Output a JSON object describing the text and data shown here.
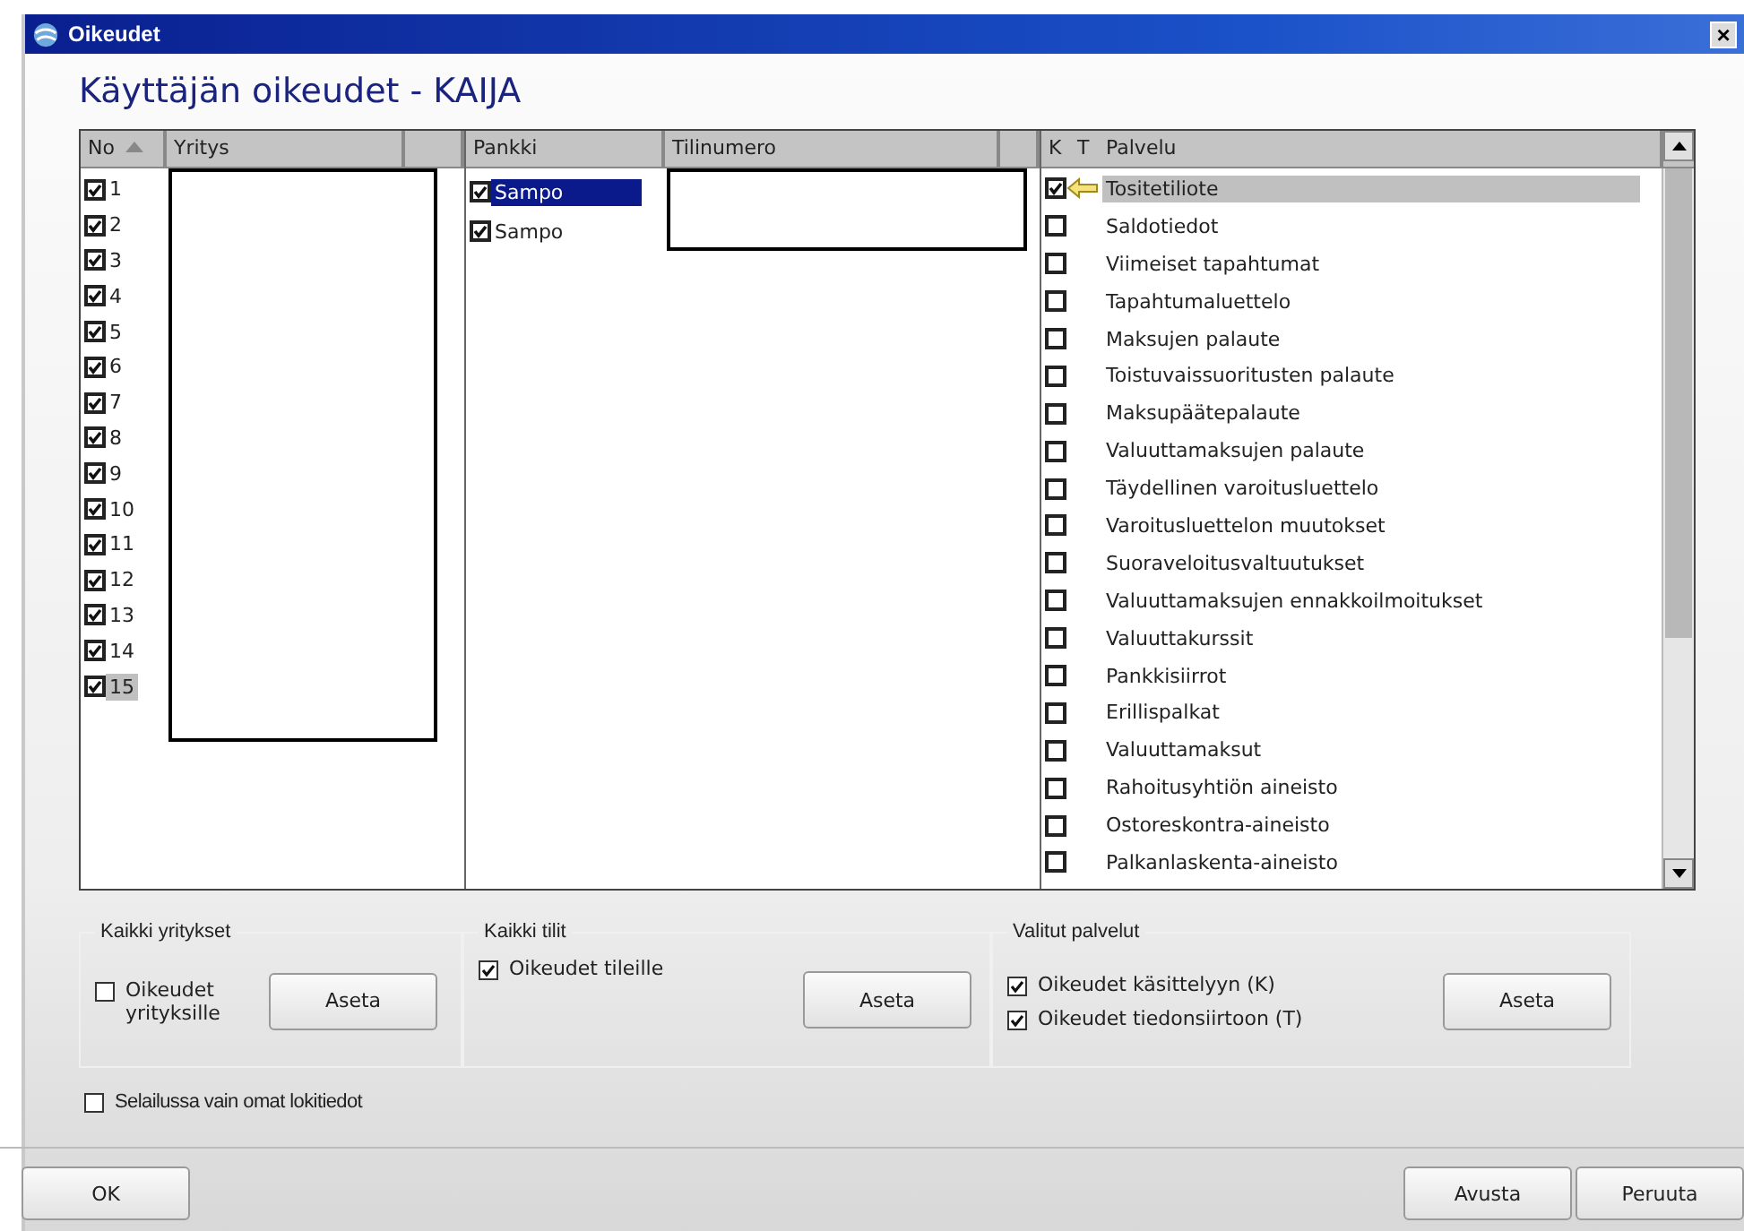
{
  "window": {
    "title": "Oikeudet",
    "close": "×"
  },
  "heading": "Käyttäjän oikeudet - KAIJA",
  "companies": {
    "columns": [
      "No",
      "Yritys"
    ],
    "rows": [
      {
        "no": "1",
        "checked": true,
        "selected": false
      },
      {
        "no": "2",
        "checked": true,
        "selected": false
      },
      {
        "no": "3",
        "checked": true,
        "selected": false
      },
      {
        "no": "4",
        "checked": true,
        "selected": false
      },
      {
        "no": "5",
        "checked": true,
        "selected": false
      },
      {
        "no": "6",
        "checked": true,
        "selected": false
      },
      {
        "no": "7",
        "checked": true,
        "selected": false
      },
      {
        "no": "8",
        "checked": true,
        "selected": false
      },
      {
        "no": "9",
        "checked": true,
        "selected": false
      },
      {
        "no": "10",
        "checked": true,
        "selected": false
      },
      {
        "no": "11",
        "checked": true,
        "selected": false
      },
      {
        "no": "12",
        "checked": true,
        "selected": false
      },
      {
        "no": "13",
        "checked": true,
        "selected": false
      },
      {
        "no": "14",
        "checked": true,
        "selected": false
      },
      {
        "no": "15",
        "checked": true,
        "selected": true
      }
    ]
  },
  "accounts": {
    "columns": [
      "Pankki",
      "Tilinumero"
    ],
    "rows": [
      {
        "bank": "Sampo",
        "checked": true,
        "selected": true
      },
      {
        "bank": "Sampo",
        "checked": true,
        "selected": false
      }
    ]
  },
  "services": {
    "columns": [
      "K",
      "T",
      "Palvelu"
    ],
    "rows": [
      {
        "name": "Tositetiliote",
        "checked": true,
        "selected": true
      },
      {
        "name": "Saldotiedot",
        "checked": false,
        "selected": false
      },
      {
        "name": "Viimeiset tapahtumat",
        "checked": false,
        "selected": false
      },
      {
        "name": "Tapahtumaluettelo",
        "checked": false,
        "selected": false
      },
      {
        "name": "Maksujen palaute",
        "checked": false,
        "selected": false
      },
      {
        "name": "Toistuvaissuoritusten palaute",
        "checked": false,
        "selected": false
      },
      {
        "name": "Maksupäätepalaute",
        "checked": false,
        "selected": false
      },
      {
        "name": "Valuuttamaksujen palaute",
        "checked": false,
        "selected": false
      },
      {
        "name": "Täydellinen varoitusluettelo",
        "checked": false,
        "selected": false
      },
      {
        "name": "Varoitusluettelon muutokset",
        "checked": false,
        "selected": false
      },
      {
        "name": "Suoraveloitusvaltuutukset",
        "checked": false,
        "selected": false
      },
      {
        "name": "Valuuttamaksujen ennakkoilmoitukset",
        "checked": false,
        "selected": false
      },
      {
        "name": "Valuuttakurssit",
        "checked": false,
        "selected": false
      },
      {
        "name": "Pankkisiirrot",
        "checked": false,
        "selected": false
      },
      {
        "name": "Erillispalkat",
        "checked": false,
        "selected": false
      },
      {
        "name": "Valuuttamaksut",
        "checked": false,
        "selected": false
      },
      {
        "name": "Rahoitusyhtiön aineisto",
        "checked": false,
        "selected": false
      },
      {
        "name": "Ostoreskontra-aineisto",
        "checked": false,
        "selected": false
      },
      {
        "name": "Palkanlaskenta-aineisto",
        "checked": false,
        "selected": false
      }
    ]
  },
  "groups": [
    {
      "title": "Kaikki yritykset",
      "options": [
        {
          "label": "Oikeudet yrityksille",
          "checked": false
        }
      ],
      "button": "Aseta"
    },
    {
      "title": "Kaikki tilit",
      "options": [
        {
          "label": "Oikeudet tileille",
          "checked": true
        }
      ],
      "button": "Aseta"
    },
    {
      "title": "Valitut palvelut",
      "options": [
        {
          "label": "Oikeudet käsittelyyn (K)",
          "checked": true
        },
        {
          "label": "Oikeudet tiedonsiirtoon (T)",
          "checked": true
        }
      ],
      "button": "Aseta"
    }
  ],
  "own_logs": {
    "label": "Selailussa vain omat lokitiedot",
    "checked": false
  },
  "buttons": [
    {
      "label": "OK"
    },
    {
      "label": "Avusta"
    },
    {
      "label": "Peruuta"
    }
  ]
}
